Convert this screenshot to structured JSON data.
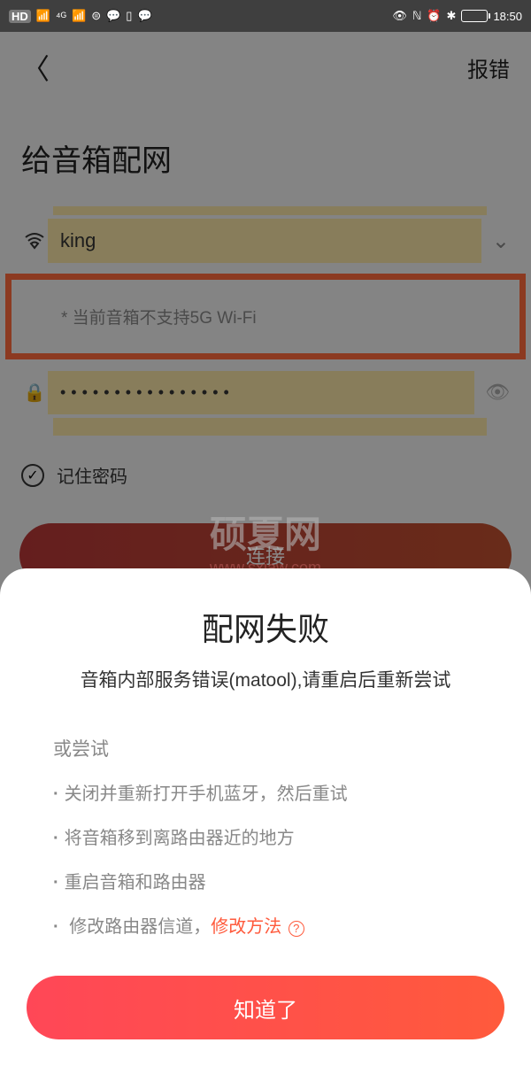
{
  "status_bar": {
    "hd": "HD",
    "signals": "⁴ᴳ",
    "time": "18:50"
  },
  "nav": {
    "report": "报错"
  },
  "page": {
    "title": "给音箱配网",
    "wifi_name": "king",
    "wifi_hint": "* 当前音箱不支持5G Wi-Fi",
    "password_dots": "••••••••••••••••",
    "remember_label": "记住密码",
    "connect_label": "连接"
  },
  "watermark": {
    "main": "硕夏网",
    "sub": "www.sxiaw.com"
  },
  "modal": {
    "title": "配网失败",
    "subtitle": "音箱内部服务错误(matool),请重启后重新尝试",
    "try_label": "或尝试",
    "tips": [
      "关闭并重新打开手机蓝牙，然后重试",
      "将音箱移到离路由器近的地方",
      "重启音箱和路由器"
    ],
    "tip4_prefix": "修改路由器信道，",
    "tip4_link": "修改方法",
    "button": "知道了"
  }
}
